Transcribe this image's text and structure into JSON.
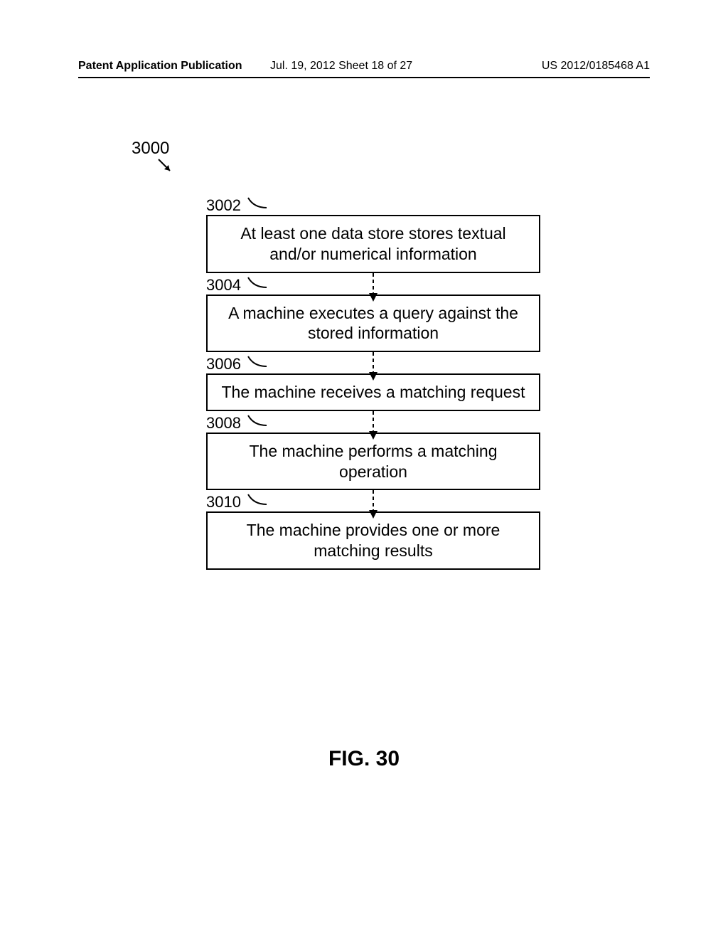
{
  "header": {
    "left": "Patent Application Publication",
    "mid": "Jul. 19, 2012  Sheet 18 of 27",
    "right": "US 2012/0185468 A1"
  },
  "figure_ref": "3000",
  "steps": [
    {
      "num": "3002",
      "text": "At least one data store stores textual and/or numerical information"
    },
    {
      "num": "3004",
      "text": "A machine executes a query against the stored information"
    },
    {
      "num": "3006",
      "text": "The machine receives a matching request"
    },
    {
      "num": "3008",
      "text": "The machine performs a matching operation"
    },
    {
      "num": "3010",
      "text": "The machine provides one or more matching results"
    }
  ],
  "caption": "FIG. 30"
}
